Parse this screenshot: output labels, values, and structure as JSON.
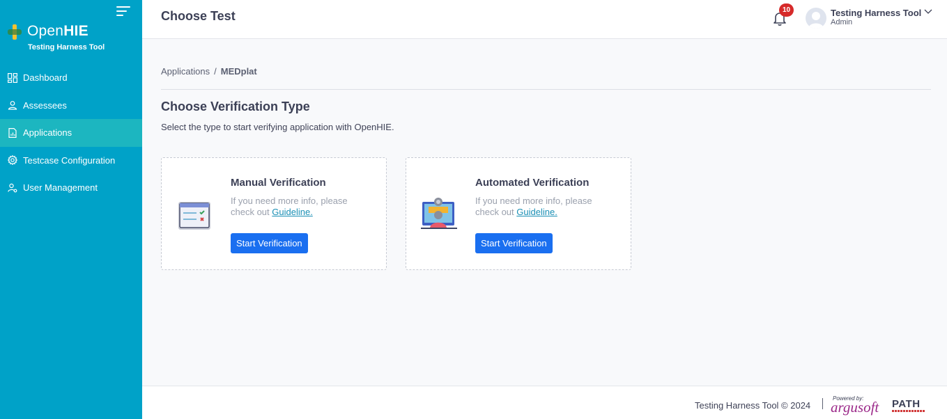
{
  "brand": {
    "name_light": "Open",
    "name_bold": "HIE",
    "subtitle": "Testing Harness Tool"
  },
  "sidebar": {
    "items": [
      {
        "label": "Dashboard",
        "icon": "dashboard-icon",
        "active": false
      },
      {
        "label": "Assessees",
        "icon": "user-icon",
        "active": false
      },
      {
        "label": "Applications",
        "icon": "document-chart-icon",
        "active": true
      },
      {
        "label": "Testcase Configuration",
        "icon": "gear-icon",
        "active": false
      },
      {
        "label": "User Management",
        "icon": "user-settings-icon",
        "active": false
      }
    ]
  },
  "header": {
    "title": "Choose Test",
    "notification_count": "10",
    "user_name": "Testing Harness Tool",
    "user_role": "Admin"
  },
  "breadcrumb": {
    "parent": "Applications",
    "separator": "/",
    "current": "MEDplat"
  },
  "main": {
    "title": "Choose Verification Type",
    "description": "Select the type to start verifying application with OpenHIE.",
    "cards": [
      {
        "title": "Manual Verification",
        "info": "If you need more info, please check out",
        "link": "Guideline.",
        "button": "Start Verification",
        "illustration": "checklist-window-icon"
      },
      {
        "title": "Automated Verification",
        "info": "If you need more info, please check out",
        "link": "Guideline.",
        "button": "Start Verification",
        "illustration": "automated-monitor-icon"
      }
    ]
  },
  "footer": {
    "copyright": "Testing Harness Tool © 2024",
    "powered_by": "Powered by:",
    "powered_brand": "argusoft",
    "partner": "PATH"
  },
  "colors": {
    "sidebar_bg": "#00a2c8",
    "sidebar_active": "#1cb6c0",
    "primary_button": "#1a6ff0",
    "badge": "#d62a2a"
  }
}
